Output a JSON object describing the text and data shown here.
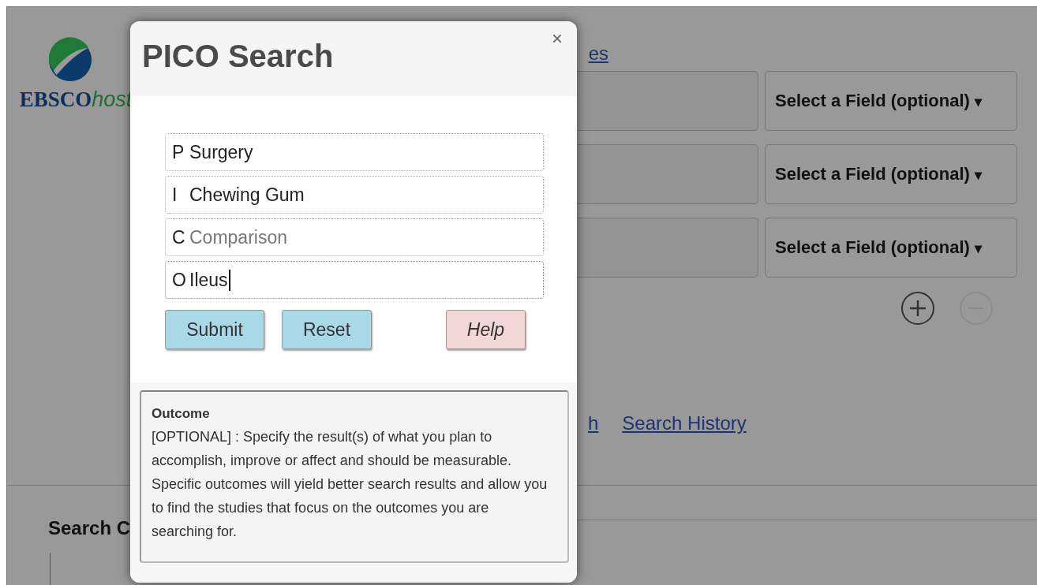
{
  "background": {
    "logo": {
      "brand": "EBSCO",
      "suffix": "host"
    },
    "header_link": "es",
    "search_rows": [
      {
        "field_select": "Select a Field (optional)",
        "caret": "▾"
      },
      {
        "field_select": "Select a Field (optional)",
        "caret": "▾"
      },
      {
        "field_select": "Select a Field (optional)",
        "caret": "▾"
      }
    ],
    "row_controls": [
      {
        "kind": "add",
        "disabled": false
      },
      {
        "kind": "remove",
        "disabled": true
      }
    ],
    "links": [
      {
        "label": "h"
      },
      {
        "label": "Search History"
      }
    ],
    "section_heading": "Search C"
  },
  "dialog": {
    "title": "PICO Search",
    "close": "×",
    "fields": [
      {
        "letter": "P",
        "value": "Surgery",
        "focused": false
      },
      {
        "letter": "I",
        "value": "Chewing Gum",
        "focused": false
      },
      {
        "letter": "C",
        "placeholder": "Comparison",
        "focused": false
      },
      {
        "letter": "O",
        "value": "Ileus",
        "focused": true
      }
    ],
    "buttons": [
      {
        "label": "Submit",
        "kind": "primary"
      },
      {
        "label": "Reset",
        "kind": "primary"
      },
      {
        "label": "Help",
        "kind": "help"
      }
    ],
    "help": {
      "title": "Outcome",
      "text": "[OPTIONAL] : Specify the result(s) of what you plan to accomplish, improve or affect and should be measurable. Specific outcomes will yield better search results and allow you to find the studies that focus on the outcomes you are searching for."
    }
  }
}
